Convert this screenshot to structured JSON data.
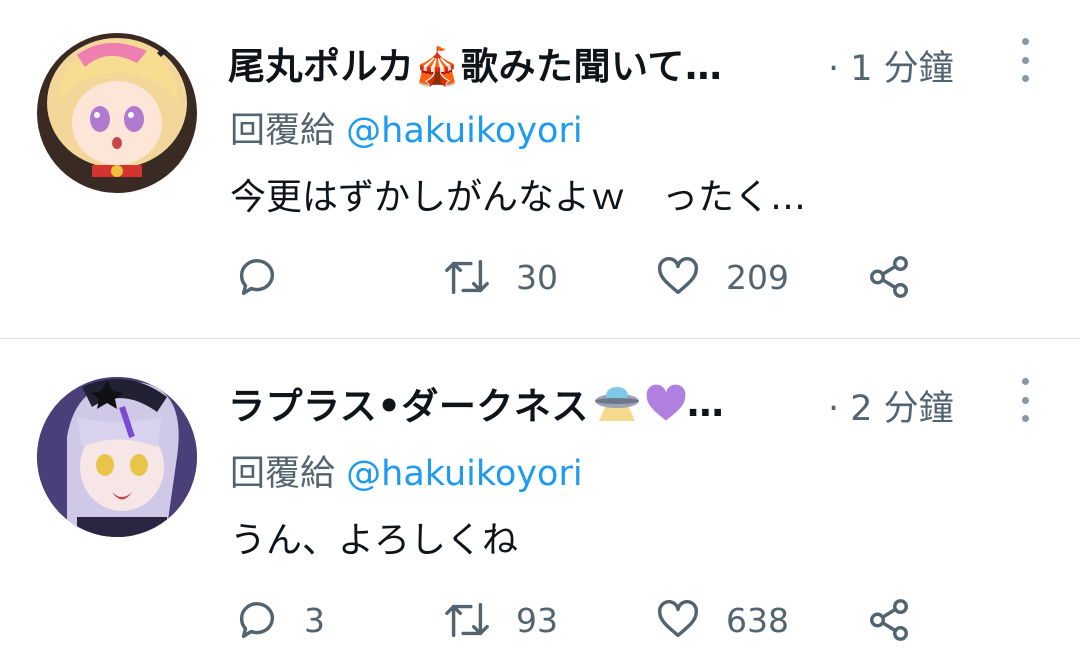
{
  "tweets": [
    {
      "author": "尾丸ポルカ🎪歌みた聞いて…",
      "time": "· 1 分鐘",
      "reply_prefix": "回覆給",
      "reply_handle": "@hakuikoyori",
      "text": "今更はずかしがんなよｗ　ったく…",
      "replies": "",
      "retweets": "30",
      "likes": "209",
      "author_emoji_icon": "circus-tent-icon"
    },
    {
      "author": "ラプラス•ダークネス",
      "author_suffix": " …",
      "time": "· 2 分鐘",
      "reply_prefix": "回覆給",
      "reply_handle": "@hakuikoyori",
      "text": "うん、よろしくね",
      "replies": "3",
      "retweets": "93",
      "likes": "638",
      "author_emoji_icons": [
        "ufo-icon",
        "purple-heart-icon"
      ]
    }
  ],
  "colors": {
    "link": "#1d9bf0",
    "muted": "#536471",
    "text": "#0f1419",
    "divider": "#dfe3e6",
    "heart": "#b080e0"
  }
}
